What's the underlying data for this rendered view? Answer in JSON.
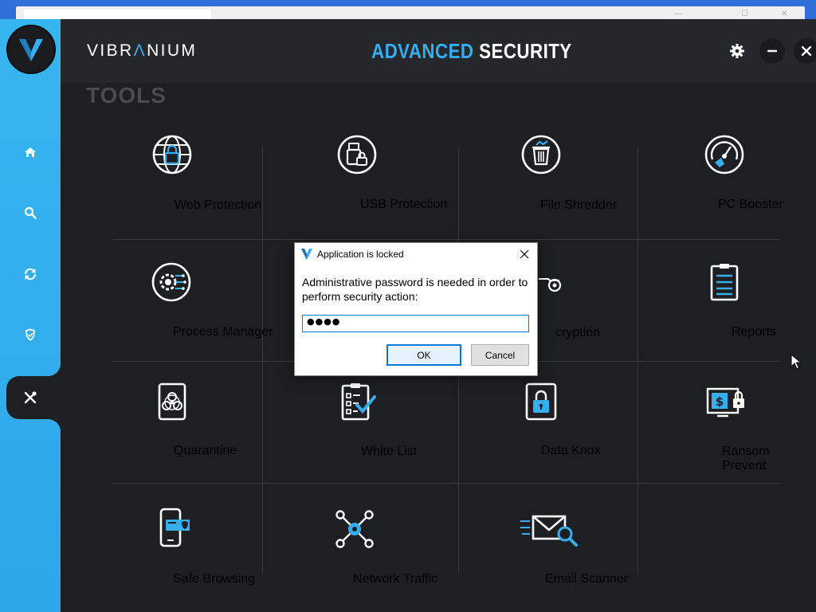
{
  "app": {
    "brand_left": "VIBR",
    "brand_accent": "Λ",
    "brand_right": "NIUM",
    "title_part1": "ADVANCED",
    "title_part2": "SECURITY"
  },
  "header_buttons": [
    "gear-icon",
    "minimize-icon",
    "close-icon"
  ],
  "sidebar": {
    "items": [
      {
        "icon": "home-icon"
      },
      {
        "icon": "search-icon"
      },
      {
        "icon": "refresh-icon"
      },
      {
        "icon": "shield-icon"
      },
      {
        "icon": "tools-icon",
        "active": true
      }
    ]
  },
  "main": {
    "section_label": "TOOLS",
    "tools": [
      {
        "label": "Web Protection",
        "icon": "globe-lock-icon"
      },
      {
        "label": "USB Protection",
        "icon": "usb-lock-icon"
      },
      {
        "label": "File Shredder",
        "icon": "shredder-icon"
      },
      {
        "label": "PC Booster",
        "icon": "speedometer-icon"
      },
      {
        "label": "Process Manager",
        "icon": "process-gear-icon"
      },
      {
        "label": "",
        "icon": "hidden-by-dialog"
      },
      {
        "label": "cryption",
        "icon": "encryption-icon"
      },
      {
        "label": "Reports",
        "icon": "clipboard-icon"
      },
      {
        "label": "Quarantine",
        "icon": "biohazard-icon"
      },
      {
        "label": "White List",
        "icon": "checklist-icon"
      },
      {
        "label": "Data Knox",
        "icon": "lock-box-icon"
      },
      {
        "label": "Ransom Prevent",
        "icon": "ransom-monitor-icon"
      },
      {
        "label": "Safe Browsing",
        "icon": "phone-shield-icon"
      },
      {
        "label": "Network Traffic",
        "icon": "network-nodes-icon"
      },
      {
        "label": "Email Scanner",
        "icon": "email-search-icon"
      }
    ]
  },
  "dialog": {
    "title": "Application is locked",
    "message": "Administrative password is needed in order to perform security action:",
    "password_value": "●●●●",
    "ok_label": "OK",
    "cancel_label": "Cancel"
  },
  "colors": {
    "accent": "#36aef0",
    "sidebar": "#2ea6ea",
    "header": "#26272b",
    "background": "#1e1f22"
  }
}
